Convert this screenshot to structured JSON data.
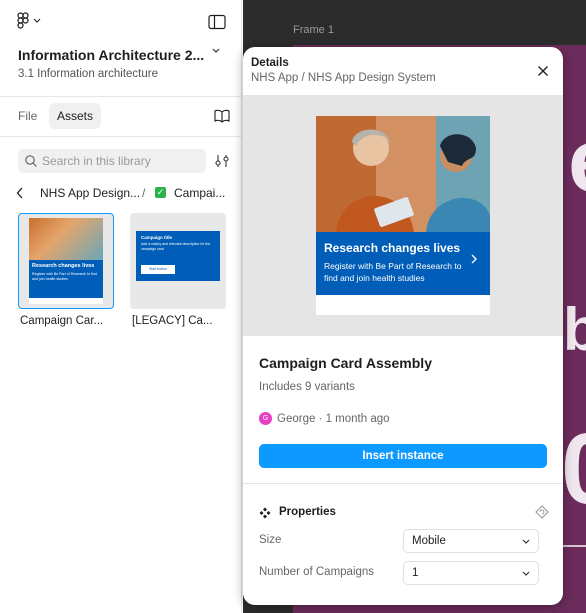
{
  "sidebar": {
    "file_title": "Information Architecture 2...",
    "file_subtitle": "3.1 Information architecture",
    "tabs": {
      "file": "File",
      "assets": "Assets"
    },
    "search": {
      "placeholder": "Search in this library"
    },
    "breadcrumb": {
      "library": "NHS App Design...",
      "separator": "/",
      "folder": "Campai..."
    },
    "assets": [
      {
        "name": "Campaign Car...",
        "thumb_title": "Research changes lives",
        "thumb_body": "Register with Be Part of Research to find and join health studies"
      },
      {
        "name": "[LEGACY] Ca...",
        "thumb_title": "Campaign title",
        "thumb_body": "Add a catchy and relevant description for the campaign card",
        "thumb_button": "Start button"
      }
    ]
  },
  "canvas": {
    "frame_label": "Frame 1",
    "visible_letters": {
      "top": "e",
      "middle": "b",
      "bottom": "0"
    }
  },
  "details": {
    "title": "Details",
    "path": "NHS App / NHS App Design System",
    "preview_card": {
      "heading": "Research changes lives",
      "body": "Register with Be Part of Research to find and join health studies"
    },
    "component_name": "Campaign Card Assembly",
    "variants": "Includes 9 variants",
    "author_initial": "G",
    "author": "George · 1 month ago",
    "insert_label": "Insert instance",
    "properties": {
      "title": "Properties",
      "items": [
        {
          "label": "Size",
          "value": "Mobile"
        },
        {
          "label": "Number of Campaigns",
          "value": "1"
        }
      ]
    }
  },
  "colors": {
    "accent": "#0d99ff",
    "nhs_blue": "#005eb8",
    "frame_bg": "#6b2c5c",
    "canvas_bg": "#2c2c2c",
    "avatar": "#e83ec2",
    "library_check": "#2bb24c"
  },
  "icons": [
    "figma-logo-icon",
    "panel-toggle-icon",
    "chevron-down-icon",
    "book-icon",
    "search-icon",
    "filter-icon",
    "chevron-left-icon",
    "close-icon",
    "component-icon",
    "reset-icon",
    "chevron-right-icon"
  ]
}
